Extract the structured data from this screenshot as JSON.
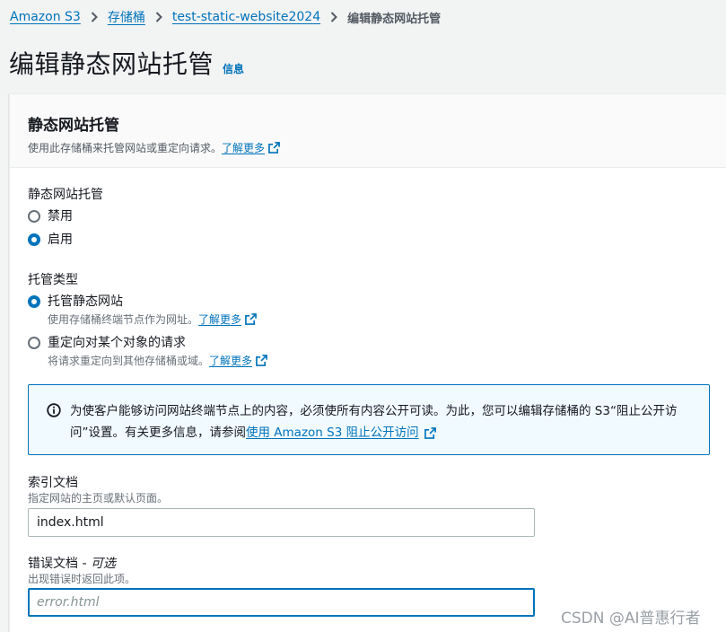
{
  "breadcrumb": {
    "items": [
      "Amazon S3",
      "存储桶",
      "test-static-website2024"
    ],
    "current": "编辑静态网站托管"
  },
  "page": {
    "title": "编辑静态网站托管",
    "info_label": "信息"
  },
  "section": {
    "title": "静态网站托管",
    "description": "使用此存储桶来托管网站或重定向请求。",
    "learn_more": "了解更多"
  },
  "hosting": {
    "label": "静态网站托管",
    "options": [
      "禁用",
      "启用"
    ],
    "selected": "启用"
  },
  "hosting_type": {
    "label": "托管类型",
    "options": [
      {
        "label": "托管静态网站",
        "description": "使用存储桶终端节点作为网址。",
        "link": "了解更多"
      },
      {
        "label": "重定向对某个对象的请求",
        "description": "将请求重定向到其他存储桶或域。",
        "link": "了解更多"
      }
    ],
    "selected": "托管静态网站"
  },
  "alert": {
    "text": "为使客户能够访问网站终端节点上的内容，必须使所有内容公开可读。为此，您可以编辑存储桶的 S3“阻止公开访问”设置。有关更多信息，请参阅",
    "link": "使用 Amazon S3 阻止公开访问"
  },
  "index_document": {
    "label": "索引文档",
    "description": "指定网站的主页或默认页面。",
    "value": "index.html"
  },
  "error_document": {
    "label": "错误文档",
    "optional_sep": " - ",
    "optional": "可选",
    "description": "出现错误时返回此项。",
    "placeholder": "error.html",
    "value": ""
  },
  "watermark": "CSDN @AI普惠行者",
  "colors": {
    "link": "#0073bb",
    "text": "#16191f",
    "muted": "#687078",
    "alert_bg": "#f1faff",
    "page_bg": "#f2f3f3"
  }
}
